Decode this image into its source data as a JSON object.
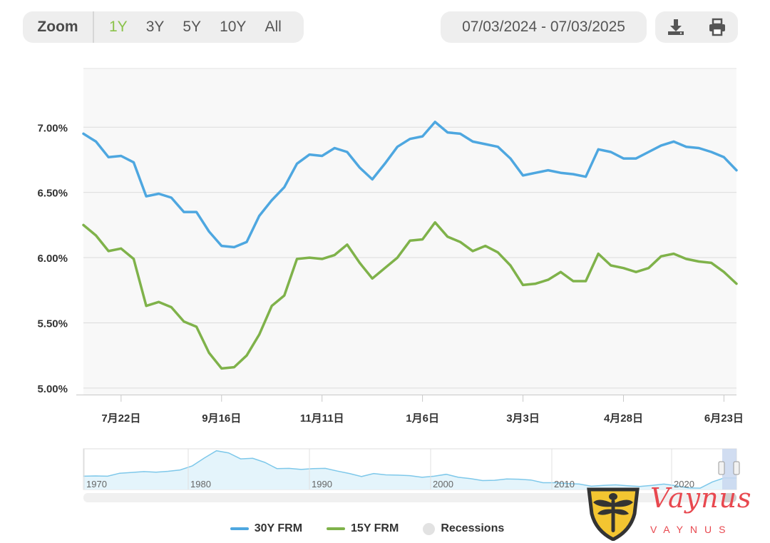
{
  "toolbar": {
    "zoom_label": "Zoom",
    "zoom_options": [
      "1Y",
      "3Y",
      "5Y",
      "10Y",
      "All"
    ],
    "active_zoom": "1Y",
    "date_range": "07/03/2024 - 07/03/2025",
    "download_icon": "download-icon",
    "print_icon": "print-icon"
  },
  "colors": {
    "series_30y": "#4ea7e0",
    "series_15y": "#7fb24a",
    "active_zoom": "#8bc34a",
    "navigator_fill": "#e4f4fb",
    "navigator_line": "#7ec8ea"
  },
  "chart_data": {
    "type": "line",
    "title": "",
    "xlabel": "",
    "ylabel": "",
    "ylim": [
      4.95,
      7.45
    ],
    "y_ticks": [
      "5.00%",
      "5.50%",
      "6.00%",
      "6.50%",
      "7.00%"
    ],
    "y_tick_values": [
      5.0,
      5.5,
      6.0,
      6.5,
      7.0
    ],
    "x_ticks": [
      "7月22日",
      "9月16日",
      "11月11日",
      "1月6日",
      "3月3日",
      "4月28日",
      "6月23日"
    ],
    "x_tick_index": [
      3,
      11,
      19,
      27,
      35,
      43,
      51
    ],
    "grid": true,
    "legend_position": "bottom",
    "x": [
      "2024-07-03",
      "2024-07-11",
      "2024-07-18",
      "2024-07-25",
      "2024-08-01",
      "2024-08-08",
      "2024-08-15",
      "2024-08-22",
      "2024-08-29",
      "2024-09-05",
      "2024-09-12",
      "2024-09-19",
      "2024-09-26",
      "2024-10-03",
      "2024-10-10",
      "2024-10-17",
      "2024-10-24",
      "2024-10-31",
      "2024-11-07",
      "2024-11-14",
      "2024-11-21",
      "2024-11-27",
      "2024-12-05",
      "2024-12-12",
      "2024-12-19",
      "2024-12-26",
      "2025-01-02",
      "2025-01-09",
      "2025-01-16",
      "2025-01-23",
      "2025-01-30",
      "2025-02-06",
      "2025-02-13",
      "2025-02-20",
      "2025-02-27",
      "2025-03-06",
      "2025-03-13",
      "2025-03-20",
      "2025-03-27",
      "2025-04-03",
      "2025-04-10",
      "2025-04-17",
      "2025-04-24",
      "2025-05-01",
      "2025-05-08",
      "2025-05-15",
      "2025-05-22",
      "2025-05-29",
      "2025-06-05",
      "2025-06-12",
      "2025-06-18",
      "2025-06-26",
      "2025-07-03"
    ],
    "series": [
      {
        "name": "30Y FRM",
        "values": [
          6.95,
          6.89,
          6.77,
          6.78,
          6.73,
          6.47,
          6.49,
          6.46,
          6.35,
          6.35,
          6.2,
          6.09,
          6.08,
          6.12,
          6.32,
          6.44,
          6.54,
          6.72,
          6.79,
          6.78,
          6.84,
          6.81,
          6.69,
          6.6,
          6.72,
          6.85,
          6.91,
          6.93,
          7.04,
          6.96,
          6.95,
          6.89,
          6.87,
          6.85,
          6.76,
          6.63,
          6.65,
          6.67,
          6.65,
          6.64,
          6.62,
          6.83,
          6.81,
          6.76,
          6.76,
          6.81,
          6.86,
          6.89,
          6.85,
          6.84,
          6.81,
          6.77,
          6.67
        ]
      },
      {
        "name": "15Y FRM",
        "values": [
          6.25,
          6.17,
          6.05,
          6.07,
          5.99,
          5.63,
          5.66,
          5.62,
          5.51,
          5.47,
          5.27,
          5.15,
          5.16,
          5.25,
          5.41,
          5.63,
          5.71,
          5.99,
          6.0,
          5.99,
          6.02,
          6.1,
          5.96,
          5.84,
          5.92,
          6.0,
          6.13,
          6.14,
          6.27,
          6.16,
          6.12,
          6.05,
          6.09,
          6.04,
          5.94,
          5.79,
          5.8,
          5.83,
          5.89,
          5.82,
          5.82,
          6.03,
          5.94,
          5.92,
          5.89,
          5.92,
          6.01,
          6.03,
          5.99,
          5.97,
          5.96,
          5.89,
          5.8
        ]
      }
    ],
    "legend": [
      "30Y FRM",
      "15Y FRM",
      "Recessions"
    ],
    "navigator": {
      "labels": [
        "1970",
        "1980",
        "1990",
        "2000",
        "2010",
        "2020"
      ],
      "values": [
        7.4,
        7.5,
        7.4,
        8.5,
        8.8,
        9.1,
        8.9,
        9.2,
        9.7,
        11.2,
        14.1,
        16.8,
        16.0,
        13.8,
        14.0,
        12.5,
        10.2,
        10.3,
        9.9,
        10.2,
        10.3,
        9.3,
        8.4,
        7.3,
        8.4,
        7.9,
        7.8,
        7.6,
        7.0,
        7.4,
        8.1,
        7.0,
        6.5,
        5.8,
        5.9,
        6.4,
        6.3,
        6.0,
        5.0,
        5.0,
        4.7,
        4.5,
        3.7,
        4.0,
        4.2,
        3.9,
        3.6,
        4.0,
        4.5,
        3.9,
        3.1,
        3.0,
        5.3,
        6.8,
        6.7
      ]
    }
  },
  "legend_labels": {
    "s30": "30Y FRM",
    "s15": "15Y FRM",
    "recessions": "Recessions"
  },
  "logo": {
    "text": "Vaynus",
    "subtext": "VAYNUS",
    "icon": "dragonfly-shield-icon"
  }
}
